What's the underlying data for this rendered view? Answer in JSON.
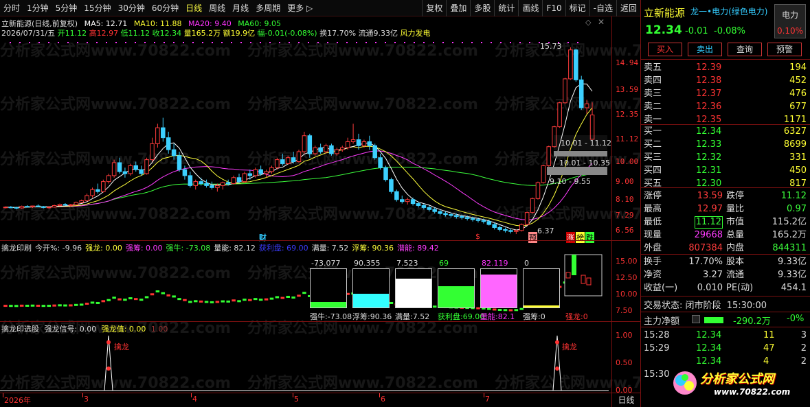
{
  "toolbar": {
    "periods": [
      "分时",
      "1分钟",
      "5分钟",
      "15分钟",
      "30分钟",
      "60分钟",
      "日线",
      "周线",
      "月线",
      "多周期",
      "更多 ▷"
    ],
    "active_period": "日线",
    "tools": [
      "复权",
      "叠加",
      "多股",
      "统计",
      "画线",
      "F10",
      "标记",
      "-自选",
      "返回"
    ]
  },
  "title": {
    "line0": "立新能源(日线,前复权)",
    "ma5": "MA5: 12.71",
    "ma10": "MA10: 11.88",
    "ma20": "MA20: 9.40",
    "ma60": "MA60: 9.05",
    "date": "2026/07/31/五",
    "open": "开11.12",
    "high": "高12.97",
    "low": "低11.12",
    "close": "收12.34",
    "vol": "量165.2万",
    "amt": "额19.9亿",
    "chg": "幅-0.01(-0.08%)",
    "turn": "换17.70%",
    "float": "流通9.33亿",
    "concept": "风力发电"
  },
  "colors": {
    "up": "#ff3c3c",
    "down": "#3cd0ff",
    "ma5": "#ffffff",
    "ma10": "#ffff3c",
    "ma20": "#ff3cff",
    "ma60": "#3cff3c"
  },
  "main_axis": [
    "14.94",
    "13.59",
    "12.35",
    "11.12",
    "10.00",
    "9.00",
    "8.10",
    "7.29",
    "6.56"
  ],
  "annotations": {
    "high_label": "15.73",
    "low_label": "6.37",
    "zone1": "10.01 - 11.12",
    "zone2": "10.01 - 10.35",
    "zone3": "9.10 - 9.55",
    "tag_cai": "财",
    "tag_s": "$",
    "tag_yu": "预",
    "tag_zhang": "涨",
    "tag_bang": "榜",
    "tag_die": "跌"
  },
  "sub1": {
    "name": "擒龙印刷",
    "items": [
      {
        "label": "今开%: -9.96",
        "color": "#ddd"
      },
      {
        "label": "强龙: 0.00",
        "color": "#ffff3c"
      },
      {
        "label": "强筹: 0.00",
        "color": "#ff3cff"
      },
      {
        "label": "强牛: -73.08",
        "color": "#3cff3c"
      },
      {
        "label": "量能: 82.12",
        "color": "#ddd"
      },
      {
        "label": "获利盘: 69.00",
        "color": "#3c3cff"
      },
      {
        "label": "满量: 7.52",
        "color": "#ddd"
      },
      {
        "label": "浮筹: 90.36",
        "color": "#ffff3c"
      },
      {
        "label": "潜能: 89.42",
        "color": "#ff3cff"
      }
    ],
    "axis": [
      "15.00",
      "12.50",
      "10.00",
      "7.50"
    ],
    "box_tops": [
      "-73.077",
      "90.355",
      "7.523",
      "69",
      "82.119",
      "0"
    ],
    "box_bottoms": [
      "强牛:-73.08",
      "浮筹:90.36",
      "满量:7.52",
      "获利盘:69.00",
      "量能:82.1",
      "强筹:0",
      "强龙:0"
    ]
  },
  "sub2": {
    "name": "擒龙印选股",
    "signal": "强龙信号: 0.00",
    "value": "强龙值: 0.00",
    "scale": "1.00",
    "axis": [
      "1.00",
      "0.50",
      "0.00"
    ],
    "marker": "擒龙"
  },
  "xaxis": {
    "labels": [
      "2026年",
      "3",
      "4",
      "5",
      "6",
      "7"
    ],
    "period_btn": "日线"
  },
  "quote": {
    "name": "立新能源",
    "sector_tag": "龙一•电力(绿色电力)",
    "sector_box": "电力",
    "sector_pct": "0.10%",
    "price": "12.34",
    "change": "-0.01",
    "pct": "-0.08%",
    "buttons": [
      "买入",
      "卖出",
      "查询",
      "预警"
    ],
    "asks": [
      {
        "label": "卖五",
        "price": "12.39",
        "vol": "194"
      },
      {
        "label": "卖四",
        "price": "12.38",
        "vol": "452"
      },
      {
        "label": "卖三",
        "price": "12.37",
        "vol": "476"
      },
      {
        "label": "卖二",
        "price": "12.36",
        "vol": "677"
      },
      {
        "label": "卖一",
        "price": "12.35",
        "vol": "1171"
      }
    ],
    "bids": [
      {
        "label": "买一",
        "price": "12.34",
        "vol": "6327"
      },
      {
        "label": "买二",
        "price": "12.33",
        "vol": "8699"
      },
      {
        "label": "买三",
        "price": "12.32",
        "vol": "331"
      },
      {
        "label": "买四",
        "price": "12.31",
        "vol": "450"
      },
      {
        "label": "买五",
        "price": "12.30",
        "vol": "817"
      }
    ],
    "stats": [
      {
        "k1": "涨停",
        "v1": "13.59",
        "c1": "#ff3c3c",
        "k2": "跌停",
        "v2": "11.12",
        "c2": "#3cff3c"
      },
      {
        "k1": "最高",
        "v1": "12.97",
        "c1": "#ff3c3c",
        "k2": "量比",
        "v2": "0.97",
        "c2": "#3cff3c"
      },
      {
        "k1": "最低",
        "v1": "11.12",
        "c1": "#3cff3c",
        "k2": "市值",
        "v2": "115.2亿",
        "c2": "#ddd"
      },
      {
        "k1": "现量",
        "v1": "29668",
        "c1": "#ff3cff",
        "k2": "总量",
        "v2": "165.2万",
        "c2": "#ddd"
      },
      {
        "k1": "外盘",
        "v1": "807384",
        "c1": "#ff3c3c",
        "k2": "内盘",
        "v2": "844311",
        "c2": "#3cff3c"
      }
    ],
    "stats2": [
      {
        "k1": "换手",
        "v1": "17.70%",
        "k2": "股本",
        "v2": "9.33亿"
      },
      {
        "k1": "净资",
        "v1": "3.27",
        "k2": "流通",
        "v2": "9.33亿"
      },
      {
        "k1": "收益(一)",
        "v1": "0.010",
        "k2": "PE(动)",
        "v2": "454.1"
      }
    ],
    "status_label": "交易状态:",
    "status_value": "闭市阶段",
    "status_time": "15:30:00",
    "flow_label": "主力净额",
    "flow_value": "-290.2万",
    "flow_pct": "-0%",
    "ticks": [
      {
        "time": "15:28",
        "price": "12.34",
        "vol": "11",
        "n": "3"
      },
      {
        "time": "15:29",
        "price": "12.34",
        "vol": "47",
        "n": "2"
      },
      {
        "time": "",
        "price": "12.34",
        "vol": "4",
        "n": "2"
      },
      {
        "time": "15:30",
        "price": "",
        "vol": "",
        "n": ""
      }
    ],
    "logo_text": "分析家公式网",
    "logo_url": "www.70822.com"
  },
  "watermark": "分析家公式网www.70822.com",
  "chart_data": {
    "type": "candlestick",
    "ohlc": [
      [
        7.7,
        7.75,
        7.66,
        7.72
      ],
      [
        7.72,
        7.78,
        7.68,
        7.7
      ],
      [
        7.7,
        7.74,
        7.62,
        7.68
      ],
      [
        7.68,
        7.8,
        7.64,
        7.76
      ],
      [
        7.76,
        7.82,
        7.7,
        7.74
      ],
      [
        7.74,
        7.8,
        7.68,
        7.78
      ],
      [
        7.78,
        7.86,
        7.72,
        7.74
      ],
      [
        7.74,
        7.78,
        7.66,
        7.7
      ],
      [
        7.7,
        7.76,
        7.64,
        7.72
      ],
      [
        7.72,
        7.84,
        7.7,
        7.8
      ],
      [
        7.8,
        7.9,
        7.76,
        7.86
      ],
      [
        7.86,
        7.92,
        7.8,
        7.82
      ],
      [
        7.82,
        7.88,
        7.74,
        7.84
      ],
      [
        7.84,
        8.0,
        7.8,
        7.96
      ],
      [
        7.96,
        8.1,
        7.92,
        8.04
      ],
      [
        8.04,
        8.4,
        8.0,
        8.3
      ],
      [
        8.3,
        8.7,
        8.2,
        8.6
      ],
      [
        8.6,
        8.9,
        8.4,
        8.5
      ],
      [
        8.5,
        9.1,
        8.45,
        9.0
      ],
      [
        9.0,
        9.4,
        8.9,
        9.3
      ],
      [
        9.3,
        10.1,
        9.2,
        9.95
      ],
      [
        9.95,
        10.2,
        9.4,
        9.5
      ],
      [
        9.5,
        9.7,
        9.2,
        9.4
      ],
      [
        9.4,
        9.9,
        9.3,
        9.8
      ],
      [
        9.8,
        10.0,
        9.5,
        9.6
      ],
      [
        9.6,
        9.8,
        9.3,
        9.4
      ],
      [
        9.4,
        10.2,
        9.35,
        10.1
      ],
      [
        10.1,
        11.2,
        10.0,
        10.9
      ],
      [
        10.9,
        11.9,
        10.7,
        11.7
      ],
      [
        11.7,
        12.2,
        11.0,
        11.2
      ],
      [
        11.2,
        11.5,
        10.4,
        10.6
      ],
      [
        10.6,
        10.9,
        10.1,
        10.3
      ],
      [
        10.3,
        10.5,
        9.5,
        9.6
      ],
      [
        9.6,
        9.8,
        9.1,
        9.3
      ],
      [
        9.3,
        9.5,
        8.7,
        8.8
      ],
      [
        8.8,
        9.1,
        8.6,
        9.0
      ],
      [
        9.0,
        9.2,
        8.8,
        8.9
      ],
      [
        8.9,
        9.1,
        8.7,
        8.8
      ],
      [
        8.8,
        9.0,
        8.6,
        8.7
      ],
      [
        8.7,
        8.9,
        8.5,
        8.8
      ],
      [
        8.8,
        9.0,
        8.6,
        8.95
      ],
      [
        8.95,
        9.1,
        8.8,
        8.9
      ],
      [
        8.9,
        9.3,
        8.85,
        9.2
      ],
      [
        9.2,
        9.4,
        8.9,
        9.0
      ],
      [
        9.0,
        9.5,
        8.95,
        9.4
      ],
      [
        9.4,
        9.6,
        9.1,
        9.3
      ],
      [
        9.3,
        9.7,
        9.2,
        9.6
      ],
      [
        9.6,
        9.8,
        9.3,
        9.4
      ],
      [
        9.4,
        9.6,
        9.2,
        9.5
      ],
      [
        9.5,
        9.8,
        9.4,
        9.7
      ],
      [
        9.7,
        10.2,
        9.6,
        10.1
      ],
      [
        10.1,
        10.4,
        9.8,
        9.9
      ],
      [
        9.9,
        10.3,
        9.85,
        10.2
      ],
      [
        10.2,
        10.5,
        9.9,
        10.0
      ],
      [
        10.0,
        10.6,
        9.95,
        10.5
      ],
      [
        10.5,
        11.5,
        10.4,
        11.3
      ],
      [
        11.3,
        11.4,
        10.2,
        10.4
      ],
      [
        10.4,
        10.8,
        10.3,
        10.7
      ],
      [
        10.7,
        10.9,
        10.4,
        10.5
      ],
      [
        10.5,
        10.9,
        10.4,
        10.8
      ],
      [
        10.8,
        10.9,
        10.3,
        10.4
      ],
      [
        10.4,
        10.7,
        10.3,
        10.6
      ],
      [
        10.6,
        10.8,
        10.5,
        10.7
      ],
      [
        10.7,
        11.2,
        10.6,
        11.0
      ],
      [
        11.0,
        11.9,
        10.9,
        11.1
      ],
      [
        11.1,
        11.4,
        10.6,
        10.8
      ],
      [
        10.8,
        11.1,
        10.7,
        11.0
      ],
      [
        11.0,
        11.3,
        10.6,
        10.8
      ],
      [
        10.8,
        10.9,
        10.1,
        10.2
      ],
      [
        10.2,
        10.4,
        9.6,
        9.7
      ],
      [
        9.7,
        9.8,
        9.0,
        9.1
      ],
      [
        9.1,
        9.2,
        8.4,
        8.5
      ],
      [
        8.5,
        8.6,
        8.0,
        8.1
      ],
      [
        8.1,
        8.3,
        7.9,
        8.0
      ],
      [
        8.0,
        8.2,
        7.85,
        8.1
      ],
      [
        8.1,
        8.2,
        7.8,
        7.9
      ],
      [
        7.9,
        8.0,
        7.7,
        7.8
      ],
      [
        7.8,
        7.9,
        7.6,
        7.7
      ],
      [
        7.7,
        7.8,
        7.5,
        7.6
      ],
      [
        7.6,
        7.7,
        7.4,
        7.5
      ],
      [
        7.5,
        7.6,
        7.3,
        7.4
      ],
      [
        7.4,
        7.5,
        7.25,
        7.35
      ],
      [
        7.35,
        7.45,
        7.2,
        7.3
      ],
      [
        7.3,
        7.4,
        7.15,
        7.25
      ],
      [
        7.25,
        7.35,
        7.1,
        7.2
      ],
      [
        7.2,
        7.3,
        7.05,
        7.15
      ],
      [
        7.15,
        7.25,
        7.0,
        7.1
      ],
      [
        7.1,
        7.2,
        6.95,
        7.05
      ],
      [
        7.05,
        7.15,
        6.9,
        7.0
      ],
      [
        7.0,
        7.1,
        6.8,
        6.85
      ],
      [
        6.85,
        6.95,
        6.6,
        6.7
      ],
      [
        6.7,
        6.8,
        6.5,
        6.6
      ],
      [
        6.6,
        6.7,
        6.45,
        6.55
      ],
      [
        6.55,
        6.65,
        6.4,
        6.5
      ],
      [
        6.5,
        6.6,
        6.37,
        6.55
      ],
      [
        6.55,
        6.9,
        6.5,
        6.85
      ],
      [
        6.85,
        7.5,
        6.8,
        7.45
      ],
      [
        7.45,
        8.2,
        7.4,
        8.15
      ],
      [
        8.15,
        9.0,
        8.1,
        8.95
      ],
      [
        8.95,
        9.85,
        8.9,
        9.8
      ],
      [
        9.8,
        10.8,
        9.75,
        10.75
      ],
      [
        10.75,
        11.8,
        10.7,
        11.75
      ],
      [
        11.75,
        13.0,
        11.7,
        12.95
      ],
      [
        12.95,
        14.2,
        12.9,
        14.15
      ],
      [
        14.15,
        15.73,
        14.1,
        15.6
      ],
      [
        15.6,
        15.65,
        14.0,
        14.1
      ],
      [
        14.1,
        14.3,
        12.6,
        12.7
      ],
      [
        12.7,
        13.1,
        12.4,
        12.9
      ],
      [
        11.12,
        12.97,
        11.12,
        12.34
      ]
    ],
    "ma": {
      "ma5": 12.71,
      "ma10": 11.88,
      "ma20": 9.4,
      "ma60": 9.05
    },
    "ylim": [
      6.2,
      15.9
    ]
  }
}
